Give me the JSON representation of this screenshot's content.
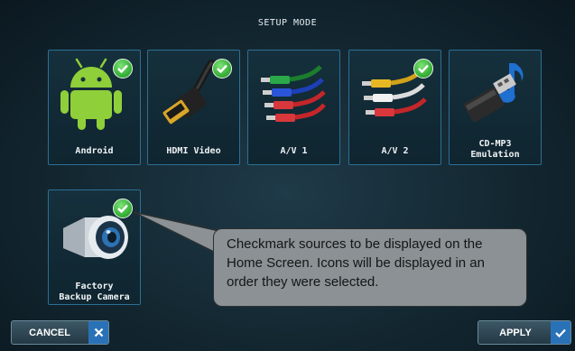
{
  "screen": {
    "title": "SETUP MODE"
  },
  "sources": [
    {
      "label": "Android",
      "icon": "android-icon",
      "checked": true
    },
    {
      "label": "HDMI Video",
      "icon": "hdmi-cable-icon",
      "checked": true
    },
    {
      "label": "A/V 1",
      "icon": "rca-cables-icon",
      "checked": false
    },
    {
      "label": "A/V 2",
      "icon": "rca-cables-icon",
      "checked": true
    },
    {
      "label_line1": "CD-MP3",
      "label_line2": "Emulation",
      "icon": "usb-music-icon",
      "checked": false
    },
    {
      "label_line1": "Factory",
      "label_line2": "Backup Camera",
      "icon": "camera-icon",
      "checked": true
    }
  ],
  "callout": {
    "text": "Checkmark sources to be displayed on the Home Screen. Icons will be displayed in an order they were selected."
  },
  "buttons": {
    "cancel_label": "CANCEL",
    "apply_label": "APPLY"
  },
  "colors": {
    "tile_border": "#2c6f95",
    "check_green": "#39b23a",
    "button_icon_blue": "#2a72b8",
    "callout_bg": "#8b9194"
  }
}
